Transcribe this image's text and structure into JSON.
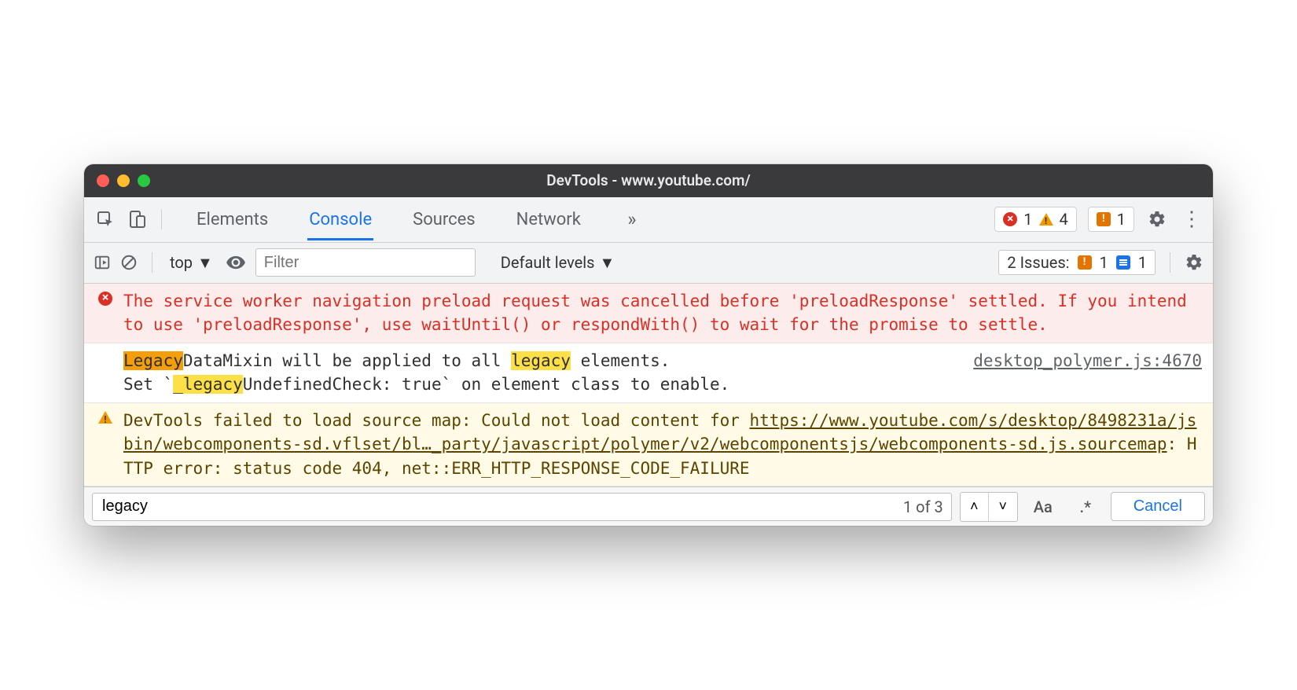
{
  "window": {
    "title": "DevTools - www.youtube.com/"
  },
  "tabs": {
    "elements": "Elements",
    "console": "Console",
    "sources": "Sources",
    "network": "Network"
  },
  "counts": {
    "errors": "1",
    "warnings": "4",
    "issues": "1"
  },
  "toolbar": {
    "context": "top",
    "filter_placeholder": "Filter",
    "levels": "Default levels",
    "issues_label": "2 Issues:",
    "issue_count1": "1",
    "issue_count2": "1"
  },
  "messages": {
    "error": "The service worker navigation preload request was cancelled before 'preloadResponse' settled. If you intend to use 'preloadResponse', use waitUntil() or respondWith() to wait for the promise to settle.",
    "log": {
      "pre1": "",
      "hl1": "Legacy",
      "mid1": "DataMixin will be applied to all ",
      "hl2": "legacy",
      "post1": " elements.",
      "line2a": "Set `",
      "hl3": "_legacy",
      "line2b": "UndefinedCheck: true` on element class to enable.",
      "source": "desktop_polymer.js:4670"
    },
    "warn": {
      "pre": "DevTools failed to load source map: Could not load content for ",
      "link": "https://www.youtube.com/s/desktop/8498231a/jsbin/webcomponents-sd.vflset/bl…_party/javascript/polymer/v2/webcomponentsjs/webcomponents-sd.js.sourcemap",
      "post": ": HTTP error: status code 404, net::ERR_HTTP_RESPONSE_CODE_FAILURE"
    }
  },
  "findbar": {
    "value": "legacy",
    "count": "1 of 3",
    "case": "Aa",
    "regex": ".*",
    "cancel": "Cancel"
  }
}
